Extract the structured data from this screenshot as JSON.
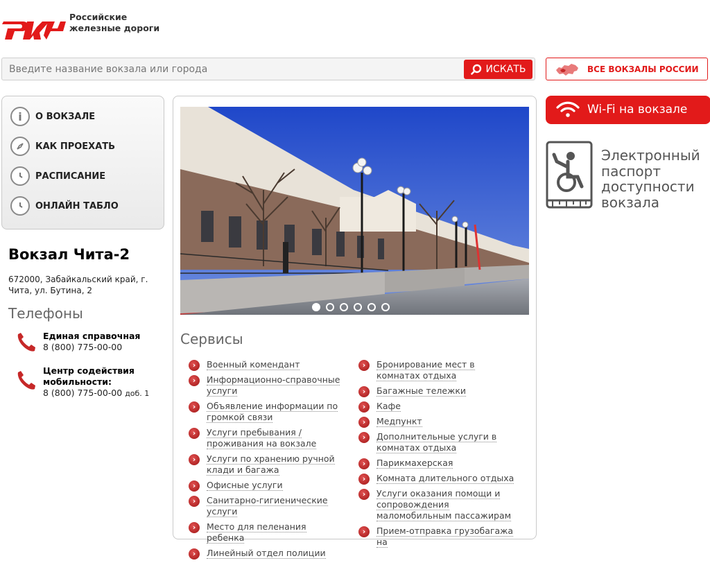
{
  "header": {
    "logo_text_line1": "Российские",
    "logo_text_line2": "железные дороги",
    "logo_mark": "РЖД"
  },
  "search": {
    "placeholder": "Введите название вокзала или города",
    "button_label": "ИСКАТЬ"
  },
  "all_stations": {
    "label": "ВСЕ ВОКЗАЛЫ РОССИИ"
  },
  "menu": {
    "items": [
      {
        "label": "О ВОКЗАЛЕ",
        "icon": "info-icon"
      },
      {
        "label": "КАК ПРОЕХАТЬ",
        "icon": "compass-icon"
      },
      {
        "label": "РАСПИСАНИЕ",
        "icon": "clock-icon"
      },
      {
        "label": "ОНЛАЙН ТАБЛО",
        "icon": "clock-icon"
      }
    ]
  },
  "station": {
    "title": "Вокзал Чита-2",
    "address": "672000, Забайкальский край, г. Чита, ул. Бутина, 2"
  },
  "phones": {
    "heading": "Телефоны",
    "items": [
      {
        "name": "Единая справочная",
        "number": "8 (800) 775-00-00",
        "ext": ""
      },
      {
        "name": "Центр содействия мобильности:",
        "number": "8 (800) 775-00-00",
        "ext": "доб. 1"
      }
    ]
  },
  "slider": {
    "dots": 6,
    "active_index": 0
  },
  "services": {
    "heading": "Сервисы",
    "left": [
      "Военный комендант",
      "Информационно-справочные услуги",
      "Объявление информации по громкой связи",
      "Услуги пребывания / проживания на вокзале",
      "Услуги по хранению ручной клади и багажа",
      "Офисные услуги",
      "Санитарно-гигиенические услуги",
      "Место для пеленания ребенка",
      "Линейный отдел полиции"
    ],
    "right": [
      "Бронирование мест в комнатах отдыха",
      "Багажные тележки",
      "Кафе",
      "Медпункт",
      "Дополнительные услуги в комнатах отдыха",
      "Парикмахерская",
      "Комната длительного отдыха",
      "Услуги оказания помощи и сопровождения маломобильным пассажирам",
      "Прием-отправка грузобагажа на"
    ]
  },
  "wifi": {
    "label": "Wi-Fi на вокзале"
  },
  "accessibility": {
    "label": "Электронный паспорт доступности вокзала"
  },
  "colors": {
    "brand_red": "#e21a1a",
    "text_gray": "#666666"
  }
}
